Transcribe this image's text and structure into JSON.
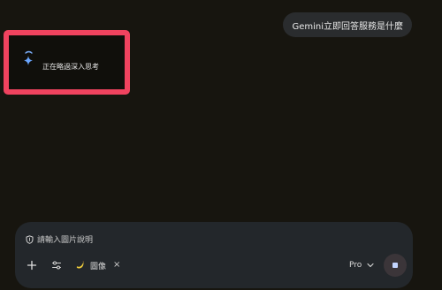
{
  "chat": {
    "user_message": "Gemini立即回答服務是什麼",
    "assistant_status": "正在略過深入思考"
  },
  "composer": {
    "placeholder": "請輸入圖片說明",
    "attachment_chip_label": "圖像",
    "model_label": "Pro"
  },
  "icons": {
    "status": "gemini-spark-icon",
    "input": "shield-icon",
    "add": "plus-icon",
    "tools": "tools-settings-icon",
    "chip": "banana-icon",
    "chip_close": "close-icon",
    "model": "chevron-down-icon",
    "stop": "stop-icon"
  },
  "colors": {
    "background": "#17150f",
    "highlight": "#f0435f",
    "composer": "#23272b",
    "user_bubble": "#2a2c2e"
  }
}
